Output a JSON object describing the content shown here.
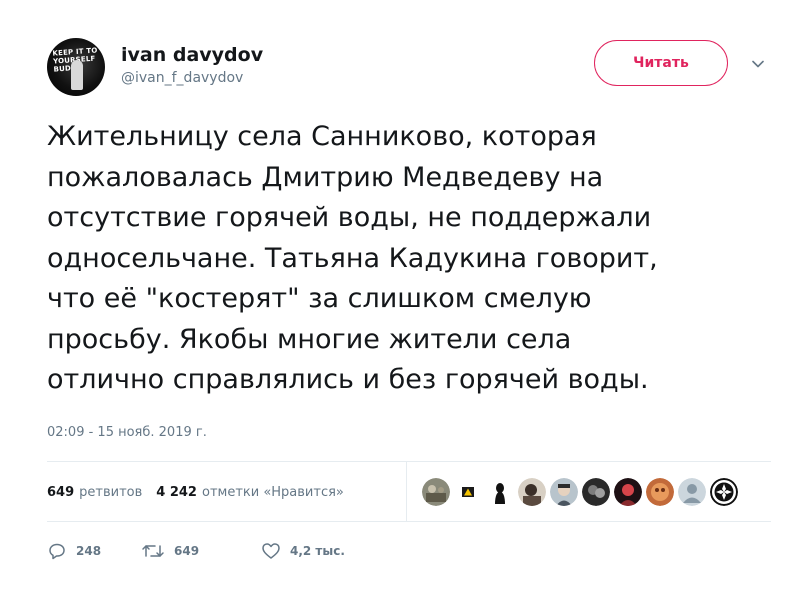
{
  "user": {
    "display_name": "ivan davydov",
    "handle": "@ivan_f_davydov",
    "avatar_text": "KEEP IT TO YOURSELF BUDDY"
  },
  "follow_button": {
    "label": "Читать"
  },
  "tweet": {
    "text": "Жительницу села Санниково, которая\nпожаловалась Дмитрию Медведеву на\nотсутствие горячей воды, не поддержали\nодносельчане. Татьяна Кадукина говорит,\nчто её \"костерят\" за слишком смелую\nпросьбу. Якобы многие жители села\nотлично справлялись и без горячей воды.",
    "timestamp": "02:09 - 15 нояб. 2019 г."
  },
  "stats": {
    "retweets_count": "649",
    "retweets_label": "ретвитов",
    "likes_count": "4 242",
    "likes_label": "отметки «Нравится»"
  },
  "actions": {
    "replies": "248",
    "retweets": "649",
    "likes": "4,2 тыс."
  },
  "colors": {
    "follow_accent": "#e0245e",
    "secondary_text": "#657786",
    "primary_text": "#14171a",
    "divider": "#e6ecf0"
  }
}
